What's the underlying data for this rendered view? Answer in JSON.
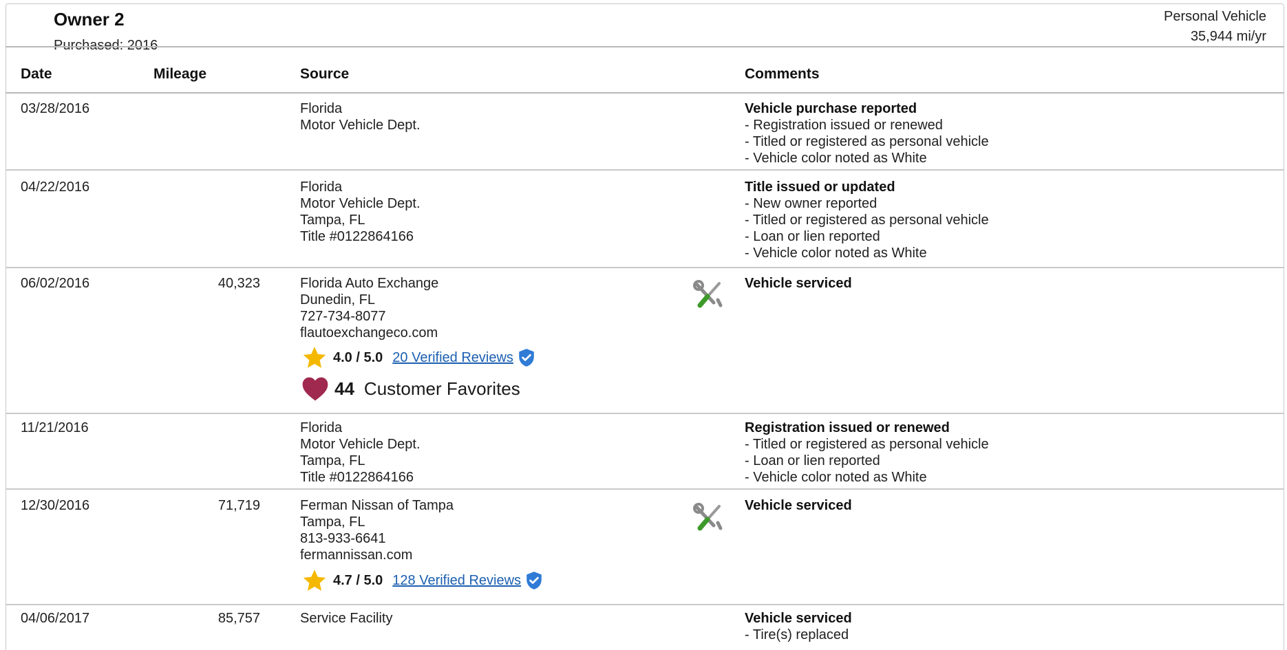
{
  "owner": {
    "title": "Owner 2",
    "purchased": "Purchased: 2016",
    "vehicle_type": "Personal Vehicle",
    "miles_per_year": "35,944 mi/yr"
  },
  "columns": {
    "date": "Date",
    "mileage": "Mileage",
    "source": "Source",
    "comments": "Comments"
  },
  "rows": [
    {
      "date": "03/28/2016",
      "mileage": "",
      "source": [
        "Florida",
        "Motor Vehicle Dept."
      ],
      "comment_title": "Vehicle purchase reported",
      "comments": [
        "- Registration issued or renewed",
        "- Titled or registered as personal vehicle",
        "- Vehicle color noted as White"
      ]
    },
    {
      "date": "04/22/2016",
      "mileage": "",
      "source": [
        "Florida",
        "Motor Vehicle Dept.",
        "Tampa, FL",
        "Title #0122864166"
      ],
      "comment_title": "Title issued or updated",
      "comments": [
        "- New owner reported",
        "- Titled or registered as personal vehicle",
        "- Loan or lien reported",
        "- Vehicle color noted as White"
      ]
    },
    {
      "date": "06/02/2016",
      "mileage": "40,323",
      "source": [
        "Florida Auto Exchange",
        "Dunedin, FL",
        "727-734-8077",
        "flautoexchangeco.com"
      ],
      "rating": {
        "score": "4.0 / 5.0",
        "reviews": "20 Verified Reviews"
      },
      "favorites": {
        "count": "44",
        "label": "Customer Favorites"
      },
      "comment_title": "Vehicle serviced",
      "comments": []
    },
    {
      "date": "11/21/2016",
      "mileage": "",
      "source": [
        "Florida",
        "Motor Vehicle Dept.",
        "Tampa, FL",
        "Title #0122864166"
      ],
      "comment_title": "Registration issued or renewed",
      "comments": [
        "- Titled or registered as personal vehicle",
        "- Loan or lien reported",
        "- Vehicle color noted as White"
      ]
    },
    {
      "date": "12/30/2016",
      "mileage": "71,719",
      "source": [
        "Ferman Nissan of Tampa",
        "Tampa, FL",
        "813-933-6641",
        "fermannissan.com"
      ],
      "rating": {
        "score": "4.7 / 5.0",
        "reviews": "128 Verified Reviews"
      },
      "comment_title": "Vehicle serviced",
      "comments": []
    },
    {
      "date": "04/06/2017",
      "mileage": "85,757",
      "source": [
        "Service Facility"
      ],
      "comment_title": "Vehicle serviced",
      "comments": [
        "- Tire(s) replaced"
      ]
    }
  ],
  "colors": {
    "link": "#1b5fb0",
    "star": "#f5b800",
    "heart": "#a0294f",
    "verified": "#2f7bd6"
  },
  "icons": {
    "service": "wrench-screwdriver-icon",
    "star": "star-icon",
    "heart": "heart-icon",
    "verified": "verified-shield-icon"
  }
}
